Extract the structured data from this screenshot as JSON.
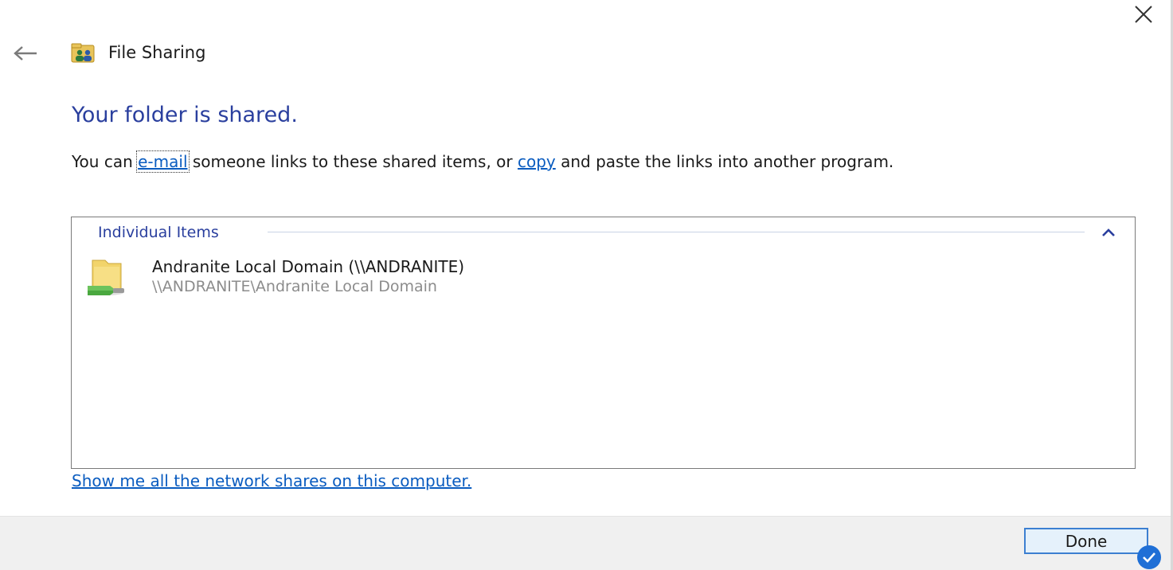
{
  "window": {
    "title": "File Sharing",
    "title_icon": "file-sharing-people-icon",
    "close_icon": "close-icon",
    "back_icon": "back-arrow-icon"
  },
  "main": {
    "heading": "Your folder is shared.",
    "description": {
      "prefix": "You can ",
      "email_link": "e-mail",
      "middle": " someone links to these shared items, or ",
      "copy_link": "copy",
      "suffix": " and paste the links into another program."
    },
    "items_group": {
      "label": "Individual Items",
      "collapse_icon": "chevron-up-icon",
      "items": [
        {
          "name": "Andranite Local Domain (\\\\ANDRANITE)",
          "path": "\\\\ANDRANITE\\Andranite Local Domain",
          "icon": "shared-folder-icon"
        }
      ]
    },
    "network_shares_link": "Show me all the network shares on this computer."
  },
  "footer": {
    "done_label": "Done",
    "badge_icon": "checkmark-icon"
  },
  "colors": {
    "heading_blue": "#2a3f9e",
    "link_blue": "#0a5cc0",
    "footer_bg": "#f0f0f0",
    "button_border": "#3c7fd1",
    "button_bg": "#e5f1fb"
  }
}
